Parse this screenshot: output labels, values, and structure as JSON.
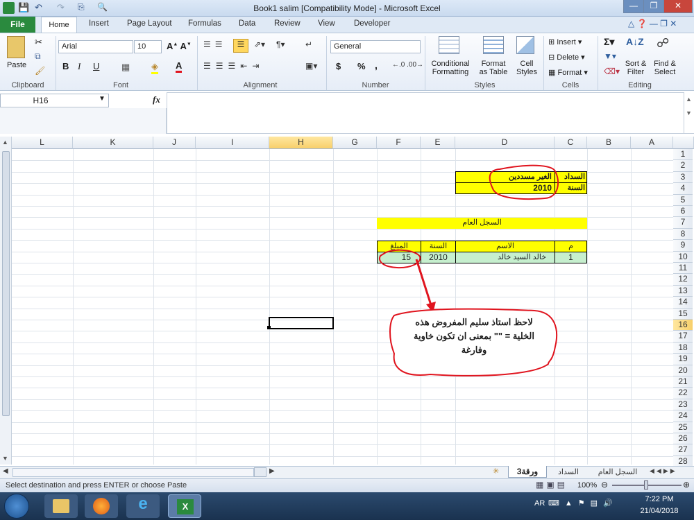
{
  "window": {
    "title": "Book1 salim  [Compatibility Mode]  -  Microsoft Excel"
  },
  "ribbon_tabs": [
    "File",
    "Home",
    "Insert",
    "Page Layout",
    "Formulas",
    "Data",
    "Review",
    "View",
    "Developer"
  ],
  "clipboard": {
    "paste": "Paste",
    "label": "Clipboard"
  },
  "font": {
    "name": "Arial",
    "size": "10",
    "label": "Font"
  },
  "alignment": {
    "label": "Alignment"
  },
  "number": {
    "format": "General",
    "label": "Number",
    "currency": "$",
    "percent": "%",
    "comma": ","
  },
  "styles": {
    "conditional": [
      "Conditional",
      "Formatting"
    ],
    "table": [
      "Format",
      "as Table"
    ],
    "cell": [
      "Cell",
      "Styles"
    ],
    "label": "Styles"
  },
  "cells": {
    "insert": "Insert",
    "delete": "Delete",
    "format": "Format",
    "label": "Cells"
  },
  "editing": {
    "sort": [
      "Sort &",
      "Filter"
    ],
    "find": [
      "Find &",
      "Select"
    ],
    "label": "Editing"
  },
  "formula_bar": {
    "name_box": "H16",
    "fx": "fx",
    "content": ""
  },
  "columns": [
    "L",
    "K",
    "J",
    "I",
    "H",
    "G",
    "F",
    "E",
    "D",
    "C",
    "B",
    "A"
  ],
  "rows": [
    "1",
    "2",
    "3",
    "4",
    "5",
    "6",
    "7",
    "8",
    "9",
    "10",
    "11",
    "12",
    "13",
    "14",
    "15",
    "16",
    "17",
    "18",
    "19",
    "20",
    "21",
    "22",
    "23",
    "24",
    "25",
    "26",
    "27",
    "28"
  ],
  "cells_content": {
    "c3": "السداد",
    "d3": "الغير مسددين",
    "c4": "السنة",
    "d4": "2010",
    "title7": "السجل العام",
    "h9c": "م",
    "h9d": "الاسم",
    "h9e": "السنة",
    "h9f": "المبلغ",
    "r10c": "1",
    "r10d": "خالد السيد خالد",
    "r10e": "2010",
    "r10f": "15"
  },
  "callout": {
    "line1": "لاحظ استاذ سليم المفروض هذه",
    "line2": "الخلية = \"\" بمعنى ان تكون خاوية",
    "line3": "وفارغة"
  },
  "sheets": [
    "السجل العام",
    "السداد",
    "ورقة3"
  ],
  "status": {
    "message": "Select destination and press ENTER or choose Paste",
    "zoom": "100%"
  },
  "taskbar": {
    "lang": "AR",
    "time": "7:22 PM",
    "date": "21/04/2018"
  },
  "colors": {
    "yellow": "#ffff00",
    "green": "#c6efce",
    "annotation_red": "#e0141e",
    "excel_green": "#2a8a3e"
  }
}
